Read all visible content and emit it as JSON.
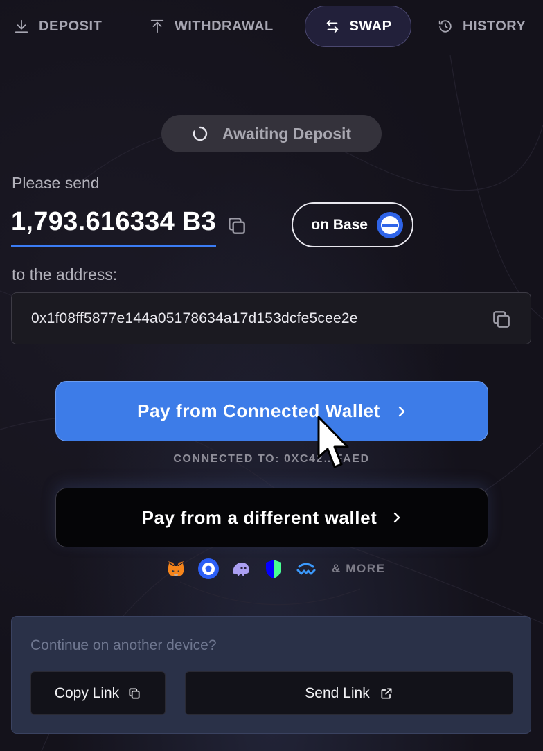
{
  "tabs": [
    {
      "label": "DEPOSIT",
      "icon": "download-icon"
    },
    {
      "label": "WITHDRAWAL",
      "icon": "upload-icon"
    },
    {
      "label": "SWAP",
      "icon": "swap-arrows-icon",
      "active": true
    },
    {
      "label": "HISTORY",
      "icon": "history-clock-icon"
    }
  ],
  "status": {
    "label": "Awaiting Deposit",
    "icon": "spinner-icon"
  },
  "send": {
    "label": "Please send",
    "amount": "1,793.616334 B3",
    "network_label": "on Base",
    "address_label": "to the address:",
    "address": "0x1f08ff5877e144a05178634a17d153dcfe5cee2e"
  },
  "actions": {
    "connected_wallet_label": "Pay from Connected Wallet",
    "connected_to": "CONNECTED TO: 0XC42…FAED",
    "different_wallet_label": "Pay from a different wallet",
    "wallets_more": "& MORE"
  },
  "wallet_icons": [
    "metamask-fox-icon",
    "coinbase-wallet-icon",
    "phantom-ghost-icon",
    "trust-shield-icon",
    "walletconnect-icon"
  ],
  "device": {
    "title": "Continue on another device?",
    "copy_link_label": "Copy Link",
    "send_link_label": "Send Link"
  },
  "colors": {
    "accent_blue": "#3d7ce8",
    "background": "#14121b",
    "base_blue": "#2f64e8"
  }
}
